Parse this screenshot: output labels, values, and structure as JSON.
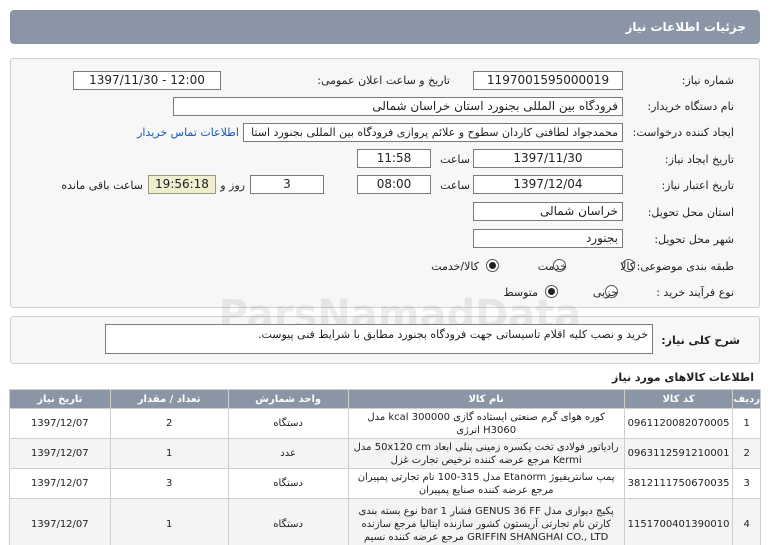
{
  "title": "جزئیات اطلاعات نیاز",
  "watermark": "ParsNamadData",
  "form": {
    "need_number_label": "شماره نیاز:",
    "need_number": "1197001595000019",
    "announce_label": "تاریخ و ساعت اعلان عمومی:",
    "announce_value": "1397/11/30 - 12:00",
    "buyer_label": "نام دستگاه خریدار:",
    "buyer_value": "فرودگاه بین المللی بجنورد استان خراسان شمالی",
    "creator_label": "ایجاد کننده درخواست:",
    "creator_value": "محمدجواد لطافتی کاردان سطوح و علائم پروازی فرودگاه بین المللی بجنورد استا",
    "contact_link": "اطلاعات تماس خریدار",
    "created_label": "تاریخ ایجاد نیاز:",
    "created_date": "1397/11/30",
    "created_time_label": "ساعت",
    "created_time": "11:58",
    "valid_label": "تاریخ اعتبار نیاز:",
    "valid_date": "1397/12/04",
    "valid_time_label": "ساعت",
    "valid_time": "08:00",
    "days": "3",
    "days_label": "روز و",
    "remaining": "19:56:18",
    "remaining_label": "ساعت باقی مانده",
    "province_label": "استان محل تحویل:",
    "province": "خراسان شمالی",
    "city_label": "شهر محل تحویل:",
    "city": "بجنورد",
    "category_label": "طبقه بندی موضوعی:",
    "category_options": [
      "کالا",
      "خدمت",
      "کالا/خدمت"
    ],
    "category_selected": "کالا/خدمت",
    "process_label": "نوع فرآیند خرید :",
    "process_options": [
      "جزیی",
      "متوسط"
    ],
    "process_selected": "متوسط"
  },
  "description": {
    "label": "شرح کلی نیاز:",
    "text": "خرید و نصب کلیه اقلام تاسیساتی جهت فرودگاه بجنورد مطابق با شرایط فنی پیوست."
  },
  "goods": {
    "title": "اطلاعات کالاهای مورد نیاز",
    "headers": [
      "ردیف",
      "کد کالا",
      "نام کالا",
      "واحد شمارش",
      "تعداد / مقدار",
      "تاریخ نیاز"
    ],
    "rows": [
      {
        "row": "1",
        "code": "0961120082070005",
        "name": "کوره هوای گرم صنعتی ایستاده گازی 300000 kcal مدل H3060 انرژی",
        "unit": "دستگاه",
        "qty": "2",
        "date": "1397/12/07"
      },
      {
        "row": "2",
        "code": "0963112591210001",
        "name": "رادیاتور فولادی تخت یکسره زمینی پنلی ابعاد 50x120 cm مدل Kermi مرجع عرضه کننده ترخیص تجارت غزل",
        "unit": "عدد",
        "qty": "1",
        "date": "1397/12/07"
      },
      {
        "row": "3",
        "code": "3812111750670035",
        "name": "پمپ سانتریفیوژ Etanorm مدل 315-100 نام تجارتی پمپیران مرجع عرضه کننده صنایع پمپیران",
        "unit": "دستگاه",
        "qty": "3",
        "date": "1397/12/07"
      },
      {
        "row": "4",
        "code": "1151700401390010",
        "name": "پکیج دیواری مدل GENUS 36 FF فشار 1 bar نوع بسته بندی کارتن نام تجارتی آریستون کشور سازنده ایتالیا مرجع سازنده GRIFFIN SHANGHAI CO., LTD مرجع عرضه کننده نسیم",
        "unit": "دستگاه",
        "qty": "1",
        "date": "1397/12/07"
      }
    ]
  }
}
